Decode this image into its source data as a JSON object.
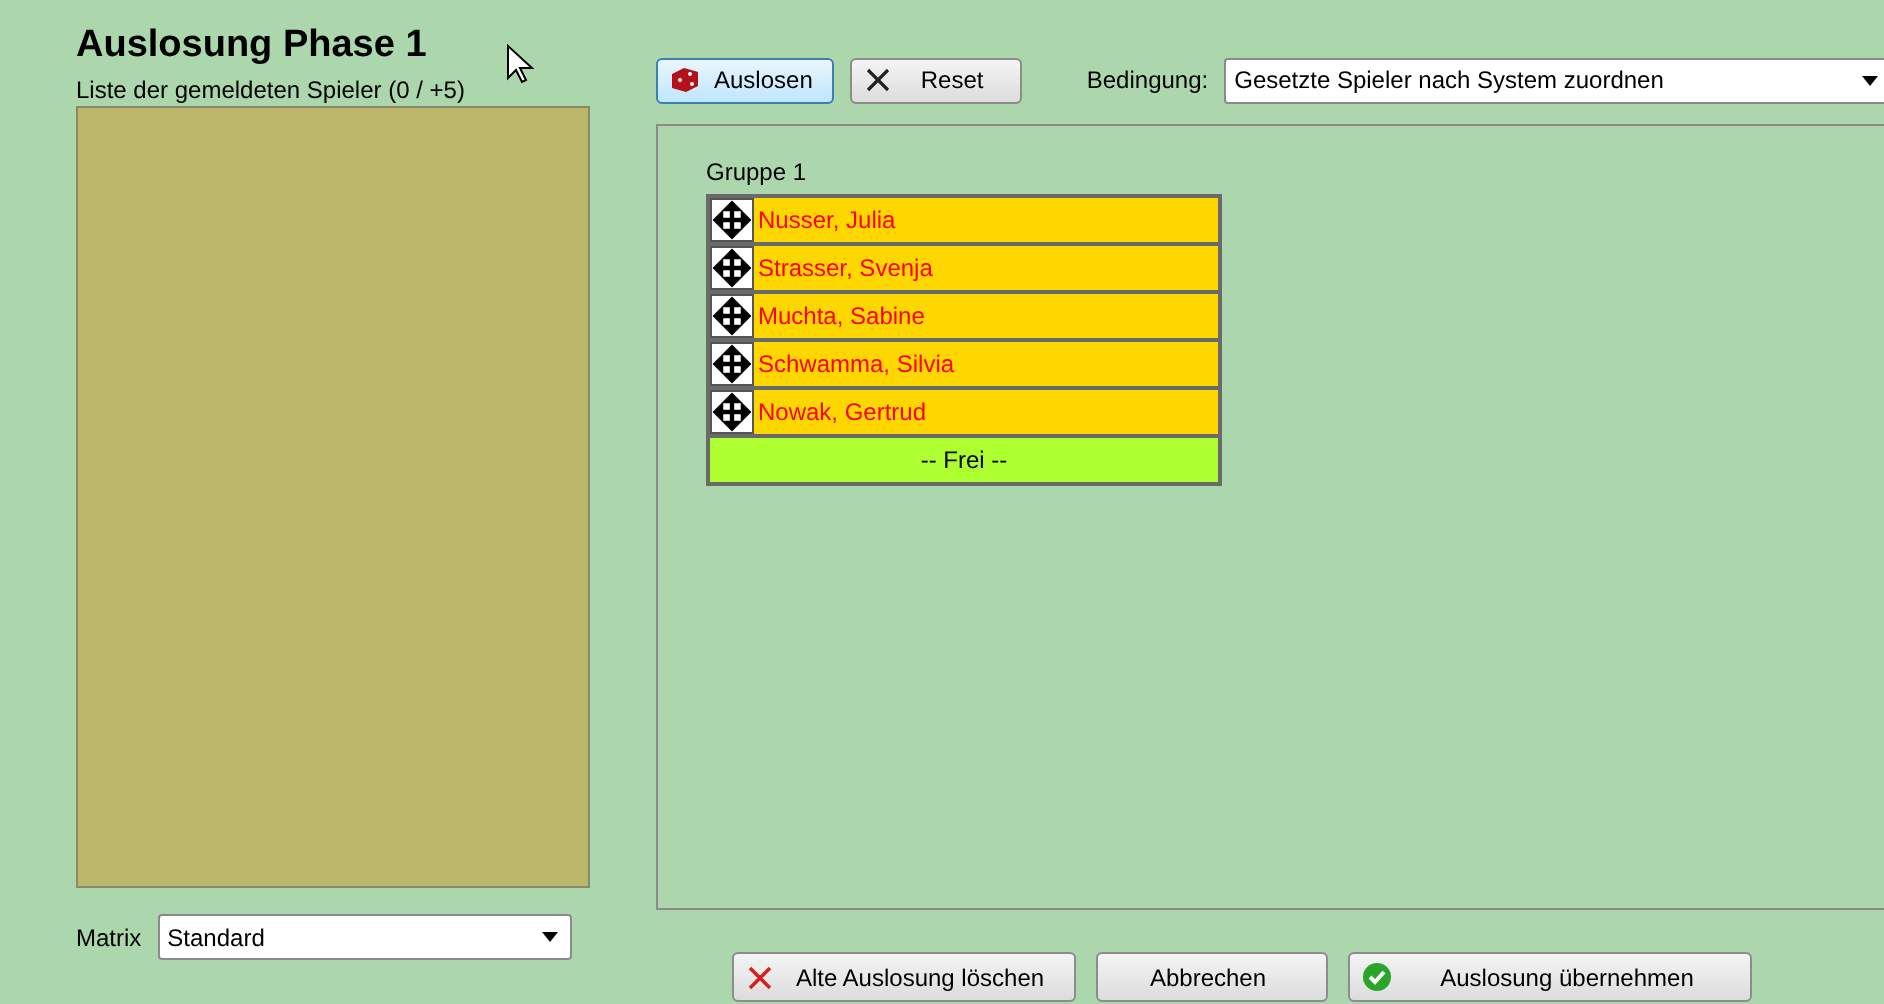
{
  "title": "Auslosung Phase 1",
  "list_label": "Liste der gemeldeten Spieler (0 / +5)",
  "toolbar": {
    "draw_button": "Auslosen",
    "reset_button": "Reset",
    "condition_label": "Bedingung:",
    "condition_value": "Gesetzte Spieler nach System zuordnen"
  },
  "groups": [
    {
      "title": "Gruppe 1",
      "entries": [
        {
          "kind": "player",
          "name": "Nusser, Julia"
        },
        {
          "kind": "player",
          "name": "Strasser, Svenja"
        },
        {
          "kind": "player",
          "name": "Muchta, Sabine"
        },
        {
          "kind": "player",
          "name": "Schwamma, Silvia"
        },
        {
          "kind": "player",
          "name": "Nowak, Gertrud"
        },
        {
          "kind": "free",
          "name": "-- Frei --"
        }
      ]
    }
  ],
  "matrix": {
    "label": "Matrix",
    "value": "Standard"
  },
  "buttons": [
    {
      "kind": "delete",
      "label": "Alte Auslosung löschen"
    },
    {
      "kind": "plain",
      "label": "Abbrechen"
    },
    {
      "kind": "accept",
      "label": "Auslosung übernehmen"
    }
  ]
}
